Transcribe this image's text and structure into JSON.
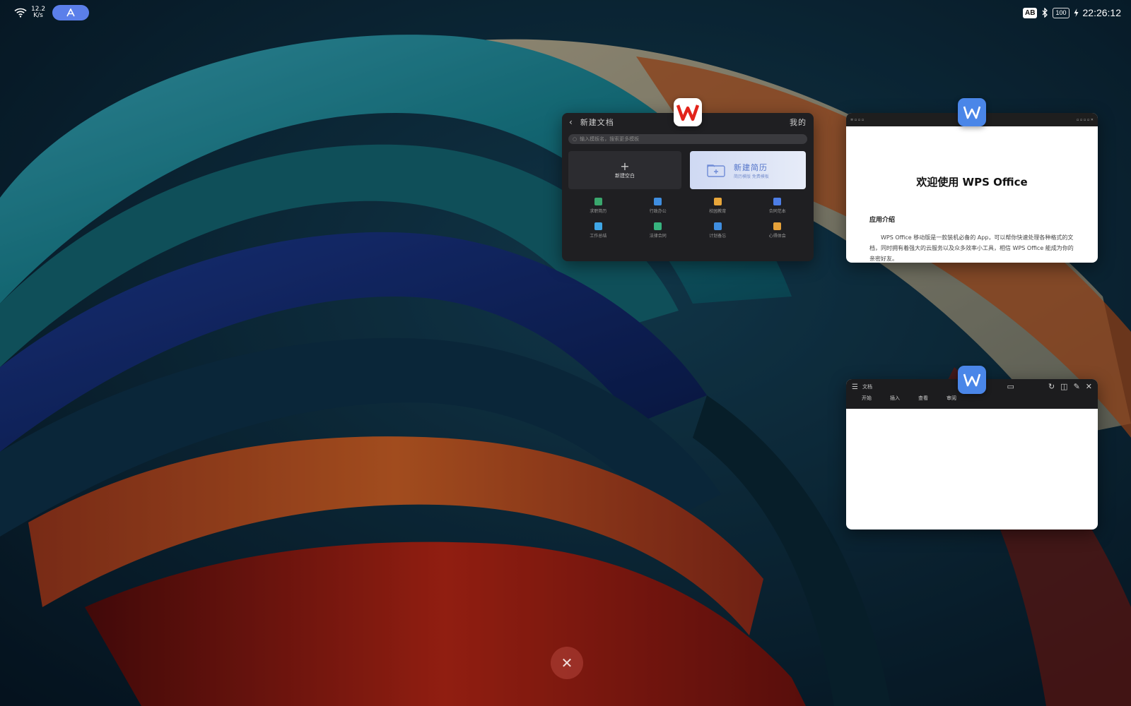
{
  "status_bar": {
    "net_speed": "12.2",
    "net_unit": "K/s",
    "ab_label": "AB",
    "battery": "100",
    "time": "22:26:12",
    "pill_icon": "a-assist-icon"
  },
  "cards": {
    "new_doc": {
      "app_icon": "wps-office-icon",
      "title": "新建文档",
      "right_label": "我的",
      "search_placeholder": "输入模板名，搜索更多模板",
      "new_blank_label": "新建空白",
      "resume_title": "新建简历",
      "resume_sub": "简历模版 免费模板",
      "tiles": [
        {
          "label": "求职简历",
          "color": "#3aa76d"
        },
        {
          "label": "行政办公",
          "color": "#3f8ee0"
        },
        {
          "label": "校园教育",
          "color": "#e8a63a"
        },
        {
          "label": "合同范本",
          "color": "#4d7ee6"
        },
        {
          "label": "工作总结",
          "color": "#3fa6e6"
        },
        {
          "label": "法律合同",
          "color": "#37b37e"
        },
        {
          "label": "计划备忘",
          "color": "#3f8ee0"
        },
        {
          "label": "心得体会",
          "color": "#e6a23a"
        }
      ]
    },
    "welcome_doc": {
      "app_icon": "wps-writer-icon",
      "title": "欢迎使用  WPS Office",
      "section": "应用介绍",
      "body": "WPS Office 移动版是一款装机必备的 App，可以帮你快速处理各种格式的文档，同时拥有着强大的云服务以及众多效率小工具，相信 WPS Office 能成为你的亲密好友。"
    },
    "blank_doc": {
      "app_icon": "wps-writer-icon",
      "doc_name": "文档",
      "tabs": [
        "开始",
        "插入",
        "查看",
        "审阅"
      ]
    }
  },
  "close_all_label": "✕"
}
